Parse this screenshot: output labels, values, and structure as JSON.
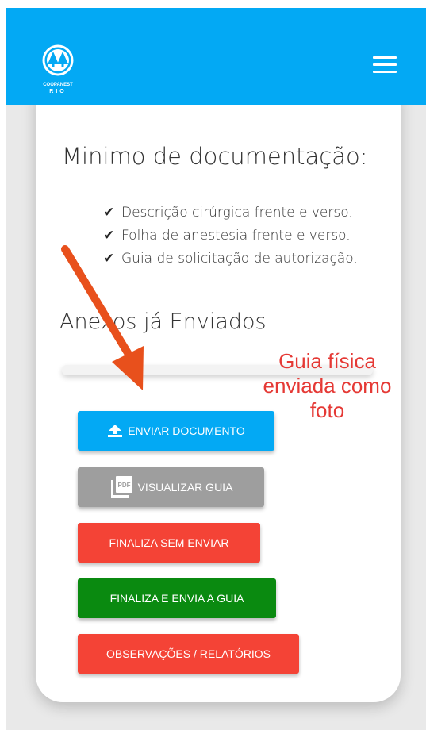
{
  "header": {
    "logo_text_top": "COOPANEST",
    "logo_text_bottom": "RIO",
    "logo_icon": "tree-logo",
    "menu_icon": "hamburger-menu-icon",
    "color": "#03a9f4"
  },
  "requirements": {
    "title": "Minimo de documentação:",
    "items": [
      "Descrição cirúrgica frente e verso.",
      "Folha de anestesia frente e verso.",
      "Guia de solicitação de autorização."
    ],
    "check_icon": "checkmark-icon"
  },
  "attachments": {
    "title": "Anexos já Enviados",
    "upload_progress": 1.0
  },
  "annotation": {
    "text": "Guia física enviada como foto",
    "color": "#e53935",
    "arrow_color": "#e8501c"
  },
  "buttons": {
    "enviar": {
      "label": "ENVIAR DOCUMENTO",
      "icon": "upload-icon",
      "color": "#03a9f4"
    },
    "visualizar": {
      "label": "VISUALIZAR GUIA",
      "icon": "pdf-icon",
      "color": "#9e9e9e"
    },
    "finaliza_sem": {
      "label": "FINALIZA SEM ENVIAR",
      "color": "#f44336"
    },
    "finaliza_envia": {
      "label": "FINALIZA E ENVIA A GUIA",
      "color": "#0a8a10"
    },
    "observacoes": {
      "label": "OBSERVAÇÕES / RELATÓRIOS",
      "color": "#f44336"
    }
  }
}
